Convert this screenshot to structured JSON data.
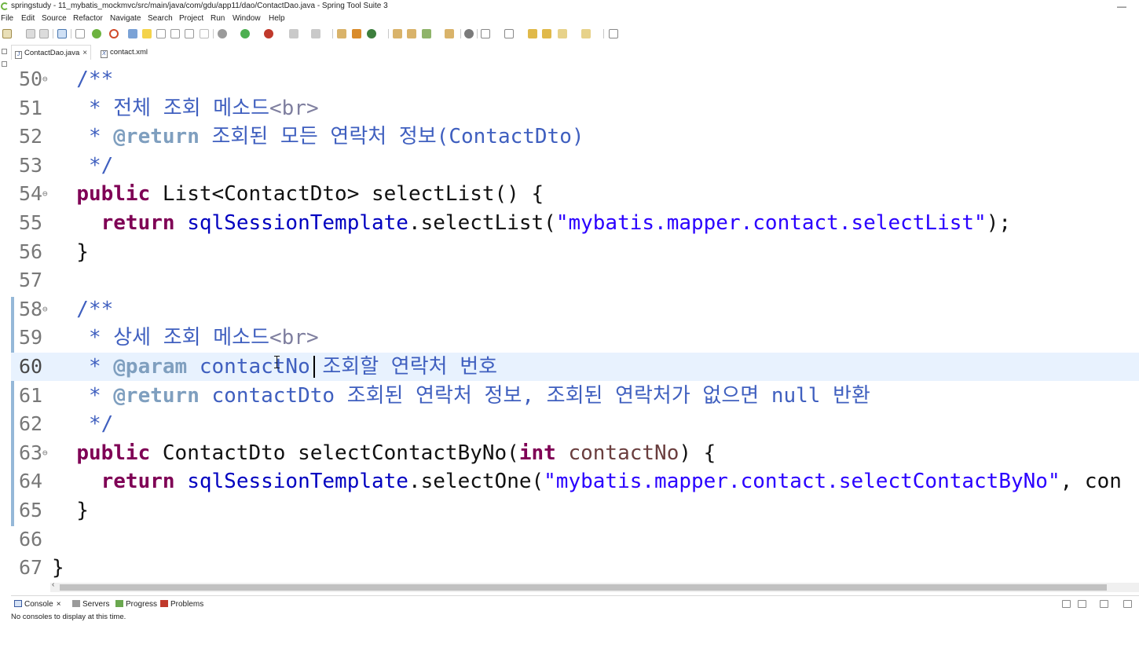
{
  "window": {
    "title": "springstudy - 11_mybatis_mockmvc/src/main/java/com/gdu/app11/dao/ContactDao.java - Spring Tool Suite 3",
    "minimize": "—"
  },
  "menu": [
    "File",
    "Edit",
    "Source",
    "Refactor",
    "Navigate",
    "Search",
    "Project",
    "Run",
    "Window",
    "Help"
  ],
  "tabs": [
    {
      "label": "ContactDao.java",
      "icon": "J",
      "close": "×",
      "active": true
    },
    {
      "label": "contact.xml",
      "icon": "X",
      "active": false
    }
  ],
  "code": {
    "current_line": "60",
    "lines": [
      {
        "no": "50",
        "fold": "⊖",
        "t": [
          [
            "jd",
            "  /**"
          ]
        ]
      },
      {
        "no": "51",
        "t": [
          [
            "jd",
            "   * 전체 조회 메소드"
          ],
          [
            "tag",
            "<br>"
          ]
        ]
      },
      {
        "no": "52",
        "t": [
          [
            "jd",
            "   * "
          ],
          [
            "at",
            "@return"
          ],
          [
            "jd",
            " 조회된 모든 연락처 정보(ContactDto)"
          ]
        ]
      },
      {
        "no": "53",
        "t": [
          [
            "jd",
            "   */"
          ]
        ]
      },
      {
        "no": "54",
        "fold": "⊖",
        "t": [
          [
            "",
            "  "
          ],
          [
            "kw",
            "public"
          ],
          [
            "",
            " List<ContactDto> selectList() {"
          ]
        ]
      },
      {
        "no": "55",
        "t": [
          [
            "",
            "    "
          ],
          [
            "kw",
            "return"
          ],
          [
            "",
            " "
          ],
          [
            "fld",
            "sqlSessionTemplate"
          ],
          [
            "",
            ".selectList("
          ],
          [
            "str",
            "\"mybatis.mapper.contact.selectList\""
          ],
          [
            "",
            ");"
          ]
        ]
      },
      {
        "no": "56",
        "t": [
          [
            "",
            "  }"
          ]
        ]
      },
      {
        "no": "57",
        "t": []
      },
      {
        "no": "58",
        "fold": "⊖",
        "t": [
          [
            "jd",
            "  /**"
          ]
        ]
      },
      {
        "no": "59",
        "t": [
          [
            "jd",
            "   * 상세 조회 메소드"
          ],
          [
            "tag",
            "<br>"
          ]
        ]
      },
      {
        "no": "60",
        "t": [
          [
            "jd",
            "   * "
          ],
          [
            "at",
            "@param"
          ],
          [
            "jd",
            " contactNo 조회할 연락처 번호"
          ]
        ]
      },
      {
        "no": "61",
        "t": [
          [
            "jd",
            "   * "
          ],
          [
            "at",
            "@return"
          ],
          [
            "jd",
            " contactDto 조회된 연락처 정보, 조회된 연락처가 없으면 null 반환"
          ]
        ]
      },
      {
        "no": "62",
        "t": [
          [
            "jd",
            "   */"
          ]
        ]
      },
      {
        "no": "63",
        "fold": "⊖",
        "t": [
          [
            "",
            "  "
          ],
          [
            "kw",
            "public"
          ],
          [
            "",
            " ContactDto selectContactByNo("
          ],
          [
            "kw",
            "int"
          ],
          [
            "",
            " "
          ],
          [
            "param",
            "contactNo"
          ],
          [
            "",
            ") {"
          ]
        ]
      },
      {
        "no": "64",
        "t": [
          [
            "",
            "    "
          ],
          [
            "kw",
            "return"
          ],
          [
            "",
            " "
          ],
          [
            "fld",
            "sqlSessionTemplate"
          ],
          [
            "",
            ".selectOne("
          ],
          [
            "str",
            "\"mybatis.mapper.contact.selectContactByNo\""
          ],
          [
            "",
            ", con"
          ]
        ]
      },
      {
        "no": "65",
        "t": [
          [
            "",
            "  }"
          ]
        ]
      },
      {
        "no": "66",
        "t": []
      },
      {
        "no": "67",
        "t": [
          [
            "",
            "}"
          ]
        ]
      }
    ]
  },
  "bottom_panel": {
    "tabs": [
      {
        "label": "Console",
        "icon": "console-icon",
        "close": "×"
      },
      {
        "label": "Servers",
        "icon": "servers-icon"
      },
      {
        "label": "Progress",
        "icon": "progress-icon"
      },
      {
        "label": "Problems",
        "icon": "problems-icon"
      }
    ],
    "message": "No consoles to display at this time."
  },
  "colors": {
    "keyword": "#7f0055",
    "javadoc": "#3f5fbf",
    "string": "#2a00ff",
    "field": "#0000c0",
    "current_line_bg": "#e8f2fe"
  }
}
